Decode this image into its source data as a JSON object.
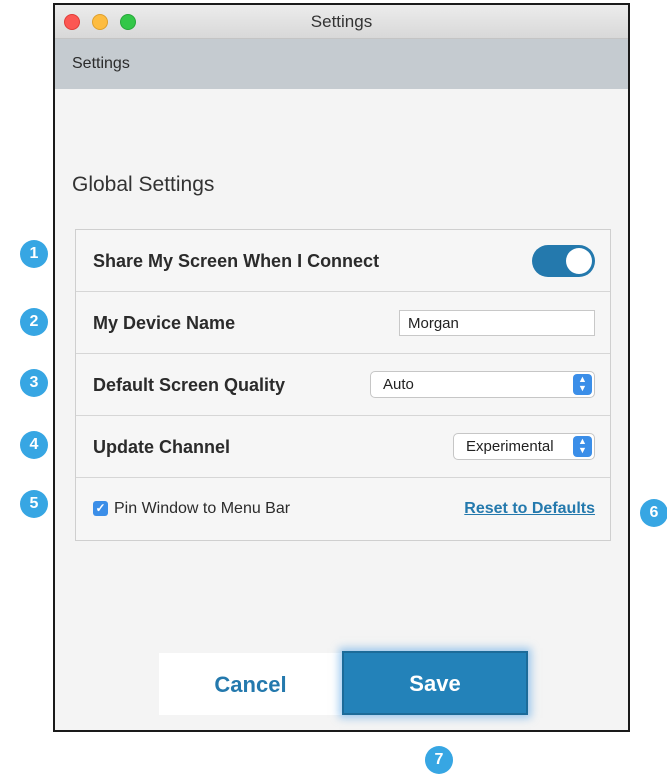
{
  "window": {
    "title": "Settings"
  },
  "subheader": {
    "label": "Settings"
  },
  "section": {
    "title": "Global Settings"
  },
  "settings": {
    "share_screen": {
      "label": "Share My Screen When I Connect",
      "enabled": true
    },
    "device_name": {
      "label": "My Device Name",
      "value": "Morgan"
    },
    "screen_quality": {
      "label": "Default Screen Quality",
      "selected": "Auto"
    },
    "update_channel": {
      "label": "Update Channel",
      "selected": "Experimental"
    },
    "pin_window": {
      "label": "Pin Window to Menu Bar",
      "checked": true
    },
    "reset": {
      "label": "Reset to Defaults"
    }
  },
  "buttons": {
    "cancel": "Cancel",
    "save": "Save"
  },
  "callouts": [
    "1",
    "2",
    "3",
    "4",
    "5",
    "6",
    "7"
  ],
  "colors": {
    "accent": "#2479ad",
    "badge": "#37a6e3",
    "control_blue": "#3b8ee8"
  }
}
